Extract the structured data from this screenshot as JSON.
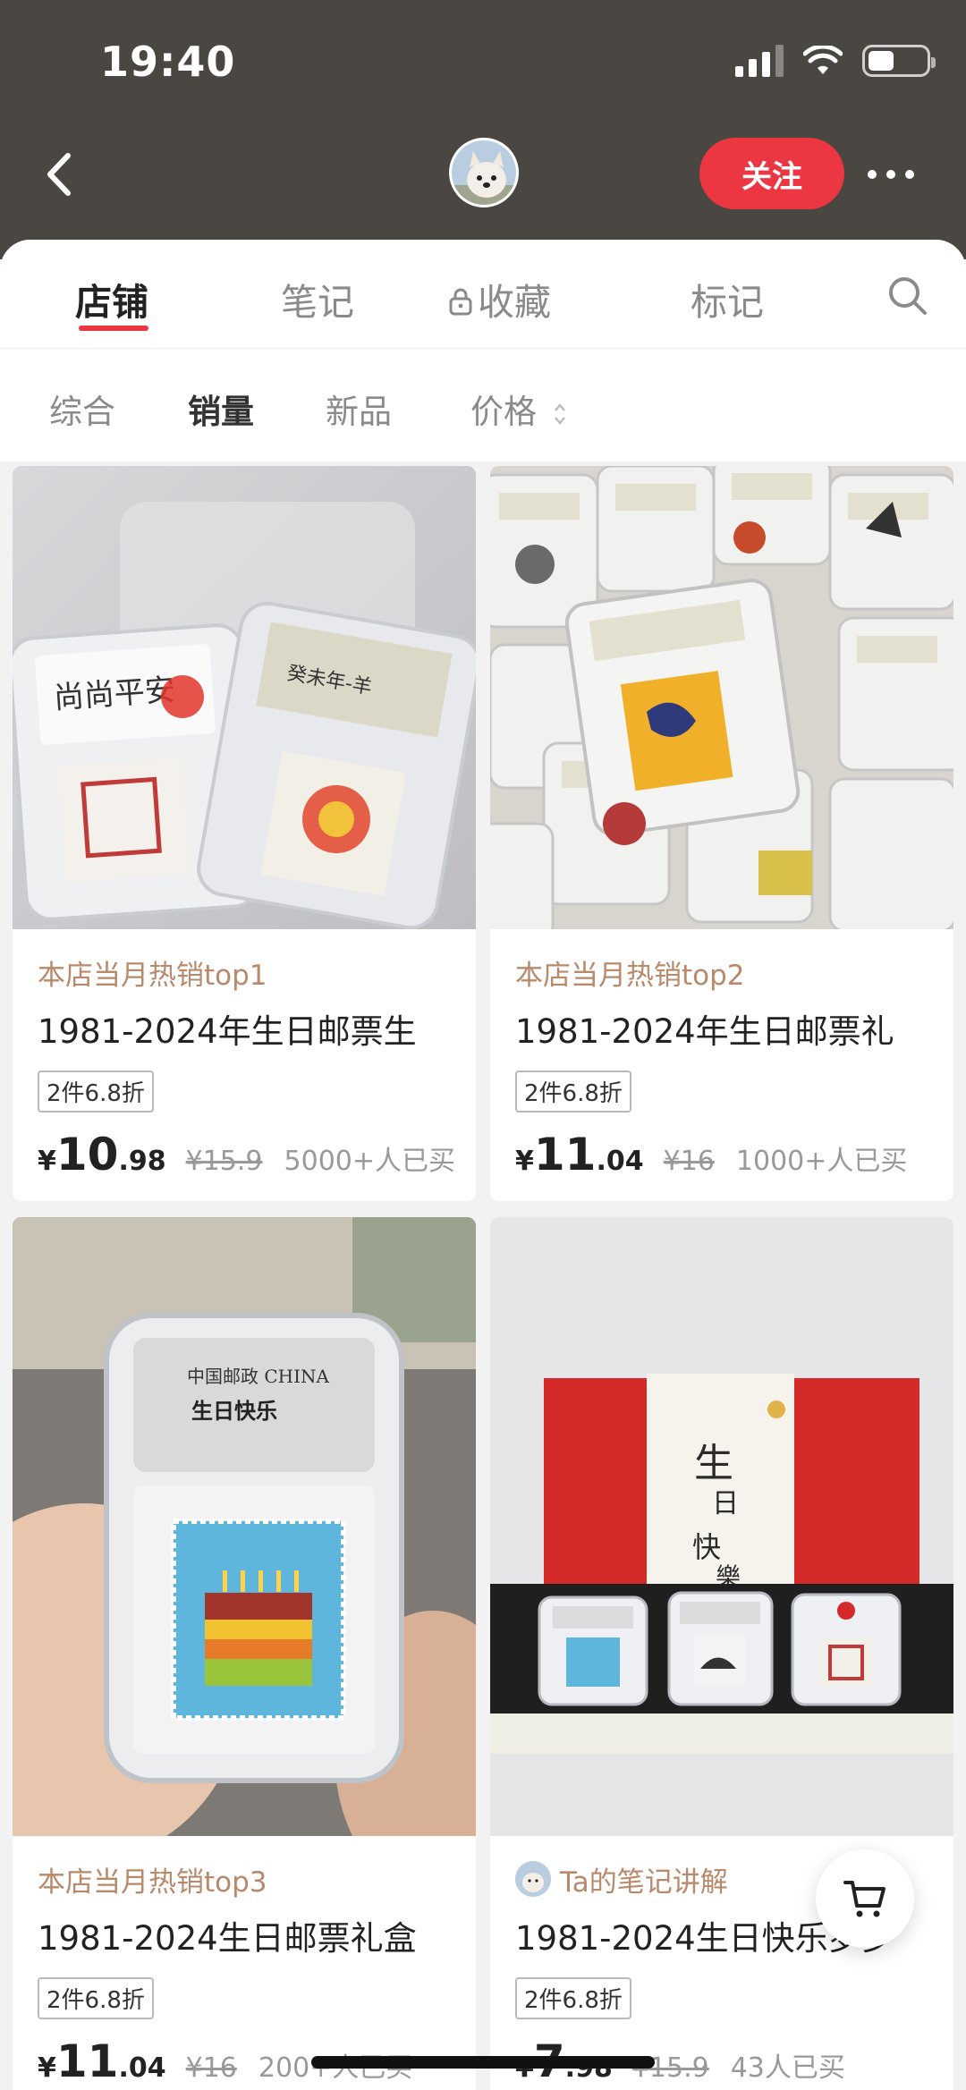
{
  "status_bar": {
    "time": "19:40"
  },
  "header": {
    "follow_label": "关注"
  },
  "tabs": [
    {
      "label": "店铺",
      "active": true
    },
    {
      "label": "笔记",
      "active": false
    },
    {
      "label": "收藏",
      "active": false,
      "icon": "lock-icon"
    },
    {
      "label": "标记",
      "active": false
    }
  ],
  "sort": [
    {
      "label": "综合",
      "active": false
    },
    {
      "label": "销量",
      "active": true
    },
    {
      "label": "新品",
      "active": false
    },
    {
      "label": "价格",
      "active": false,
      "icon": "sort-arrows-icon"
    }
  ],
  "products": [
    {
      "tagline": "本店当月热销top1",
      "title": "1981-2024年生日邮票生",
      "discount": "2件6.8折",
      "price_yen": "¥",
      "price_int": "10",
      "price_dec": ".98",
      "original_price": "¥15.9",
      "sold": "5000+人已买"
    },
    {
      "tagline": "本店当月热销top2",
      "title": "1981-2024年生日邮票礼",
      "discount": "2件6.8折",
      "price_yen": "¥",
      "price_int": "11",
      "price_dec": ".04",
      "original_price": "¥16",
      "sold": "1000+人已买"
    },
    {
      "tagline": "本店当月热销top3",
      "title": "1981-2024生日邮票礼盒",
      "discount": "2件6.8折",
      "price_yen": "¥",
      "price_int": "11",
      "price_dec": ".04",
      "original_price": "¥16",
      "sold": "200+人已买"
    },
    {
      "tagline": "Ta的笔记讲解",
      "title": "1981-2024生日快乐罗罗",
      "discount": "2件6.8折",
      "price_yen": "¥",
      "price_int": "7",
      "price_dec": ".98",
      "original_price": "¥15.9",
      "sold": "43人已买"
    }
  ],
  "colors": {
    "accent": "#ec3642",
    "header_bg": "#4a4641",
    "tagline": "#b8896b"
  }
}
